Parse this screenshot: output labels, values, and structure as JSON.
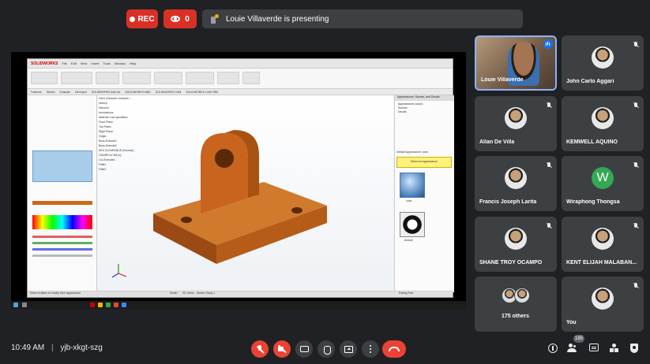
{
  "top": {
    "rec_label": "REC",
    "viewers_count": "0",
    "presenting_text": "Louie Villaverde is presenting"
  },
  "shared_screen": {
    "app_name": "SOLIDWORKS",
    "menu": [
      "File",
      "Edit",
      "View",
      "Insert",
      "Tools",
      "Window",
      "Help"
    ],
    "tabs": [
      "Features",
      "Sketch",
      "Evaluate",
      "DimXpert",
      "SOLIDWORKS Add-Ins",
      "SOLIDWORKS MBD",
      "SOLIDWORKS CAM",
      "SOLIDWORKS CAM TBM"
    ],
    "tree_items": [
      "Part1 (Default<<Default>...",
      "History",
      "Sensors",
      "Annotations",
      "Material <not specified>",
      "Front Plane",
      "Top Plane",
      "Right Plane",
      "Origin",
      "Boss-Extrude1",
      "Boss-Extrude2",
      "M10 CLEARANCE (Normal)...",
      "CBORE for M8 (b)",
      "Cut-Extrude1",
      "Fillet1",
      "Fillet2"
    ],
    "right_panel_title": "Appearances, Scenes, and Decals",
    "right_panel_items": [
      "Appearances (color)",
      "Scenes",
      "Decals"
    ],
    "selected_appearance_label": "Default Appearance: color",
    "yellow_hint": "Select an appearance",
    "thumb1_label": "color",
    "thumb2_label": "texture",
    "status_text": "Select entities to modify their appearance",
    "status_right": "Editing Part",
    "model_tabs": [
      "Model",
      "3D Views",
      "Motion Study 1"
    ],
    "part_color": "#c8641e"
  },
  "participants": [
    {
      "name": "Louie Villaverde",
      "speaking": true
    },
    {
      "name": "John Carlo Aggari"
    },
    {
      "name": "Allan De Villa"
    },
    {
      "name": "KEMWELL AQUINO"
    },
    {
      "name": "Francis Joseph Larita"
    },
    {
      "name": "Wiraphong Thongsa",
      "initial": "W"
    },
    {
      "name": "SHANE TROY OCAMPO"
    },
    {
      "name": "KENT ELIJAH MALABAN..."
    },
    {
      "name": "175 others"
    },
    {
      "name": "You"
    }
  ],
  "bottom": {
    "time": "10:49 AM",
    "separator": "|",
    "meeting_code": "yjb-xkgt-szg",
    "participant_count": "185"
  },
  "colors": {
    "background": "#202124",
    "tile": "#3c4043",
    "danger": "#ea4335",
    "accent": "#8ab4f8"
  }
}
